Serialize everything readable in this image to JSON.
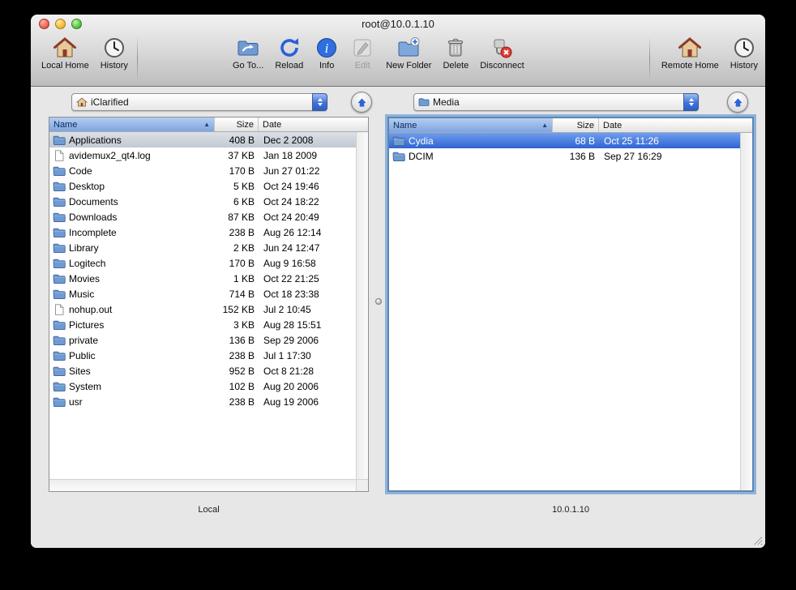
{
  "window": {
    "title": "root@10.0.1.10"
  },
  "colors": {
    "selection_active": "#2f63d0",
    "selection_inactive": "#c9cfd8",
    "focus_ring": "#7da9d9",
    "sorted_header": "#8fb0e2"
  },
  "toolbar": {
    "left": [
      {
        "label": "Local Home",
        "icon": "home-icon"
      },
      {
        "label": "History",
        "icon": "clock-icon"
      }
    ],
    "center": [
      {
        "label": "Go To...",
        "icon": "goto-folder-icon"
      },
      {
        "label": "Reload",
        "icon": "reload-icon"
      },
      {
        "label": "Info",
        "icon": "info-icon"
      },
      {
        "label": "Edit",
        "icon": "edit-icon",
        "disabled": true
      },
      {
        "label": "New Folder",
        "icon": "new-folder-icon"
      },
      {
        "label": "Delete",
        "icon": "trash-icon"
      },
      {
        "label": "Disconnect",
        "icon": "disconnect-icon"
      }
    ],
    "right": [
      {
        "label": "Remote Home",
        "icon": "home-icon"
      },
      {
        "label": "History",
        "icon": "clock-icon"
      }
    ]
  },
  "left_pane": {
    "path_selected": "iClarified",
    "columns": [
      "Name",
      "Size",
      "Date"
    ],
    "sorted_column": "Name",
    "footer": "Local",
    "rows": [
      {
        "name": "Applications",
        "size": "408 B",
        "date": "Dec 2 2008",
        "type": "folder",
        "selected": "inactive"
      },
      {
        "name": "avidemux2_qt4.log",
        "size": "37 KB",
        "date": "Jan 18 2009",
        "type": "file"
      },
      {
        "name": "Code",
        "size": "170 B",
        "date": "Jun 27 01:22",
        "type": "folder"
      },
      {
        "name": "Desktop",
        "size": "5 KB",
        "date": "Oct 24 19:46",
        "type": "folder"
      },
      {
        "name": "Documents",
        "size": "6 KB",
        "date": "Oct 24 18:22",
        "type": "folder"
      },
      {
        "name": "Downloads",
        "size": "87 KB",
        "date": "Oct 24 20:49",
        "type": "folder"
      },
      {
        "name": "Incomplete",
        "size": "238 B",
        "date": "Aug 26 12:14",
        "type": "folder"
      },
      {
        "name": "Library",
        "size": "2 KB",
        "date": "Jun 24 12:47",
        "type": "folder"
      },
      {
        "name": "Logitech",
        "size": "170 B",
        "date": "Aug 9 16:58",
        "type": "folder"
      },
      {
        "name": "Movies",
        "size": "1 KB",
        "date": "Oct 22 21:25",
        "type": "folder"
      },
      {
        "name": "Music",
        "size": "714 B",
        "date": "Oct 18 23:38",
        "type": "folder"
      },
      {
        "name": "nohup.out",
        "size": "152 KB",
        "date": "Jul 2 10:45",
        "type": "file"
      },
      {
        "name": "Pictures",
        "size": "3 KB",
        "date": "Aug 28 15:51",
        "type": "folder"
      },
      {
        "name": "private",
        "size": "136 B",
        "date": "Sep 29 2006",
        "type": "folder"
      },
      {
        "name": "Public",
        "size": "238 B",
        "date": "Jul 1 17:30",
        "type": "folder"
      },
      {
        "name": "Sites",
        "size": "952 B",
        "date": "Oct 8 21:28",
        "type": "folder"
      },
      {
        "name": "System",
        "size": "102 B",
        "date": "Aug 20 2006",
        "type": "folder"
      },
      {
        "name": "usr",
        "size": "238 B",
        "date": "Aug 19 2006",
        "type": "folder"
      }
    ]
  },
  "right_pane": {
    "path_selected": "Media",
    "columns": [
      "Name",
      "Size",
      "Date"
    ],
    "sorted_column": "Name",
    "footer": "10.0.1.10",
    "rows": [
      {
        "name": "Cydia",
        "size": "68 B",
        "date": "Oct 25 11:26",
        "type": "folder",
        "selected": "active"
      },
      {
        "name": "DCIM",
        "size": "136 B",
        "date": "Sep 27 16:29",
        "type": "folder"
      }
    ]
  }
}
